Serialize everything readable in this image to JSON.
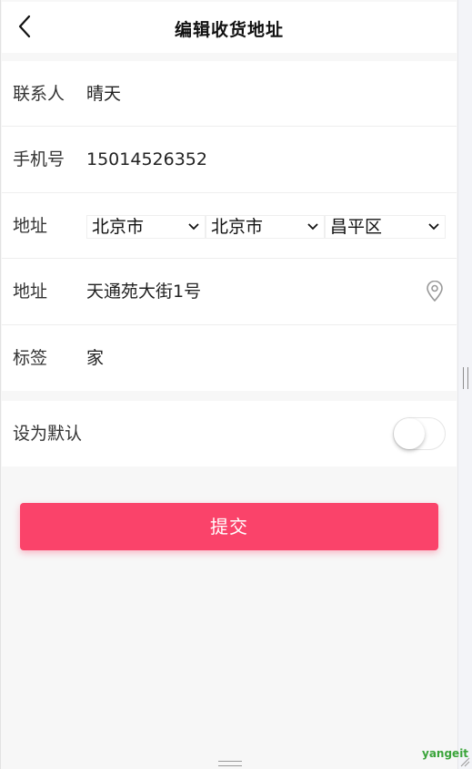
{
  "header": {
    "title": "编辑收货地址",
    "back_icon": "back-arrow-icon"
  },
  "form": {
    "contact": {
      "label": "联系人",
      "value": "晴天"
    },
    "phone": {
      "label": "手机号",
      "value": "15014526352"
    },
    "region": {
      "label": "地址",
      "province": "北京市",
      "city": "北京市",
      "district": "昌平区"
    },
    "address": {
      "label": "地址",
      "value": "天通苑大街1号",
      "icon": "location-pin-icon"
    },
    "tag": {
      "label": "标签",
      "value": "家"
    },
    "default": {
      "label": "设为默认",
      "checked": false
    }
  },
  "submit_label": "提交",
  "watermark": "yangeit",
  "colors": {
    "accent": "#fa436a",
    "background": "#f7f7f7",
    "watermark": "#3aa43a"
  }
}
